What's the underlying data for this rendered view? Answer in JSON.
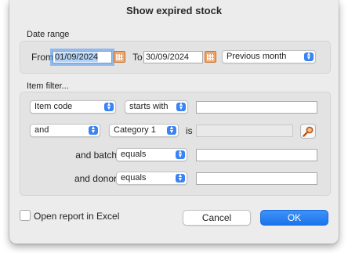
{
  "dialog": {
    "title": "Show expired stock"
  },
  "date_range": {
    "label": "Date range",
    "from_label": "From",
    "from_value_selected": "01/09/2024",
    "to_label": "To",
    "to_value": "30/09/2024",
    "preset_selected": "Previous month"
  },
  "item_filter": {
    "label": "Item filter...",
    "row1": {
      "field_selected": "Item code",
      "operator_selected": "starts with",
      "value": ""
    },
    "row2": {
      "conjunction_selected": "and",
      "field_selected": "Category 1",
      "is_label": "is",
      "value": ""
    },
    "row3": {
      "label": "and batch",
      "operator_selected": "equals",
      "value": ""
    },
    "row4": {
      "label": "and donor",
      "operator_selected": "equals",
      "value": ""
    }
  },
  "footer": {
    "open_in_excel_label": "Open report in Excel",
    "open_in_excel_checked": false,
    "cancel_label": "Cancel",
    "ok_label": "OK"
  },
  "colors": {
    "accent": "#1b74ec",
    "selection": "#b4d3f7",
    "calendar_icon": "#f2a86b"
  },
  "icons": [
    "calendar-icon",
    "search-icon",
    "popup-arrows-icon"
  ]
}
